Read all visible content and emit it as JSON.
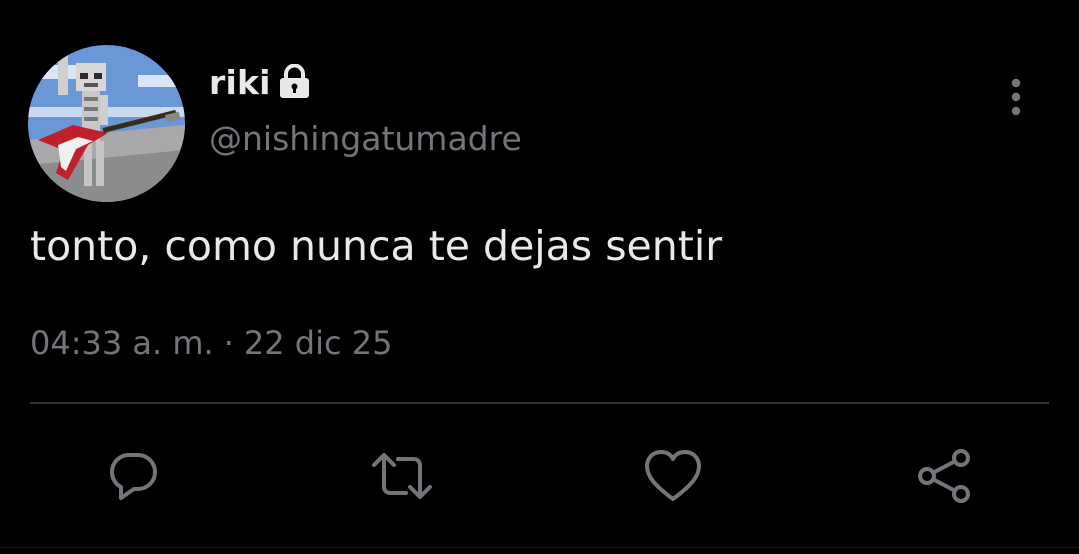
{
  "tweet": {
    "display_name": "riki",
    "handle": "@nishingatumadre",
    "text": "tonto, como nunca te dejas sentir",
    "time": "04:33 a. m.",
    "separator": "·",
    "date": "22 dic 25",
    "protected": true
  },
  "icons": {
    "avatar": "skeleton-guitar-avatar",
    "lock": "lock-icon",
    "more": "more-vertical-icon",
    "reply": "reply-icon",
    "retweet": "retweet-icon",
    "like": "heart-icon",
    "share": "share-icon"
  },
  "colors": {
    "background": "#000000",
    "primary_text": "#e7e9ea",
    "secondary_text": "#71767b",
    "divider": "#2f3336"
  }
}
